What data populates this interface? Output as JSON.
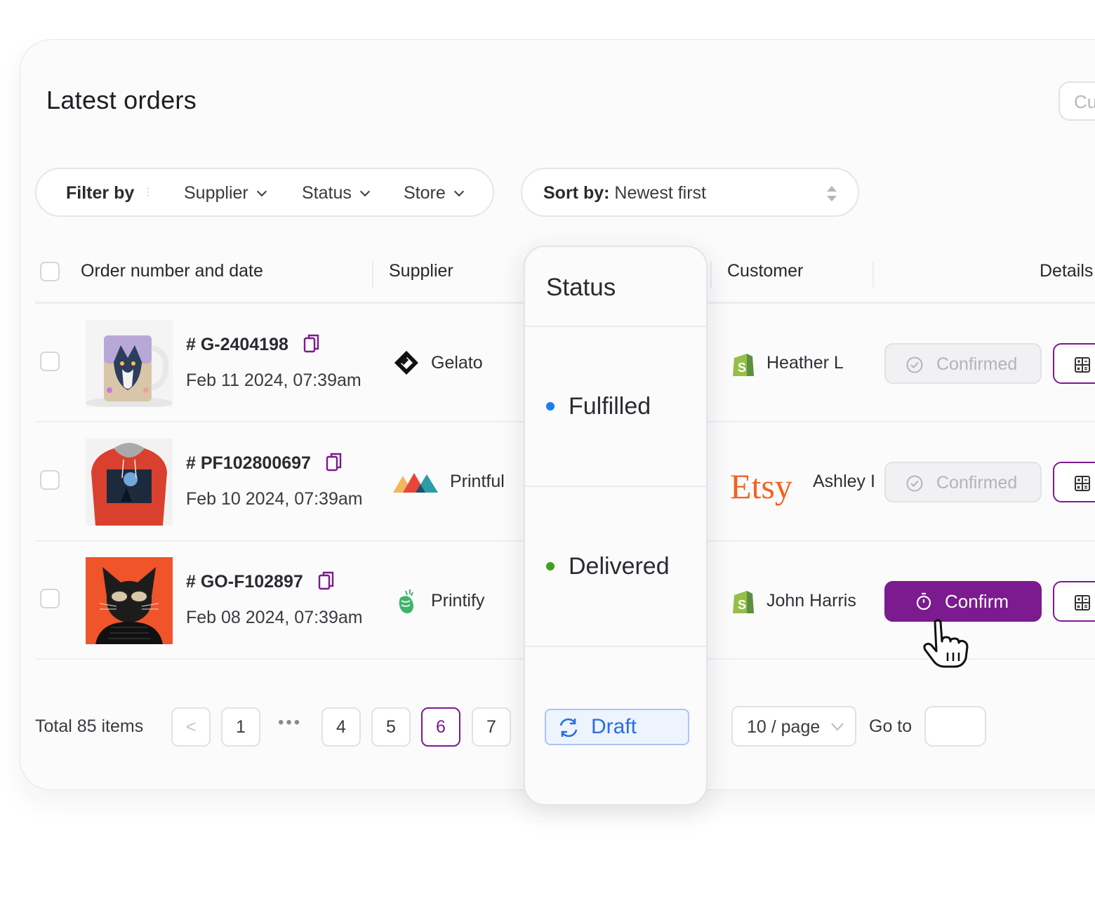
{
  "page": {
    "title": "Latest orders",
    "top_right_button": "Cu"
  },
  "filter": {
    "label": "Filter by",
    "items": [
      "Supplier",
      "Status",
      "Store"
    ]
  },
  "sort": {
    "label": "Sort by:",
    "value": "Newest first"
  },
  "table": {
    "headers": {
      "order": "Order number and date",
      "supplier": "Supplier",
      "customer": "Customer",
      "details": "Details"
    },
    "rows": [
      {
        "order_no": "# G-2404198",
        "date": "Feb 11 2024, 07:39am",
        "supplier": "Gelato",
        "supplier_icon": "gelato-logo",
        "store": "shopify",
        "customer": "Heather L",
        "action": "Confirmed",
        "action_state": "disabled"
      },
      {
        "order_no": "# PF102800697",
        "date": "Feb 10 2024, 07:39am",
        "supplier": "Printful",
        "supplier_icon": "printful-logo",
        "store": "etsy",
        "store_label": "Etsy",
        "customer": "Ashley I",
        "action": "Confirmed",
        "action_state": "disabled"
      },
      {
        "order_no": "# GO-F102897",
        "date": "Feb 08 2024, 07:39am",
        "supplier": "Printify",
        "supplier_icon": "printify-logo",
        "store": "shopify",
        "customer": "John Harris",
        "action": "Confirm",
        "action_state": "primary"
      }
    ]
  },
  "status_dropdown": {
    "title": "Status",
    "options": [
      {
        "label": "Fulfilled",
        "color": "#1e7cf2"
      },
      {
        "label": "Delivered",
        "color": "#3fa21e"
      }
    ],
    "draft_label": "Draft"
  },
  "pagination": {
    "total": "Total 85 items",
    "prev": "<",
    "pages": [
      "1",
      "4",
      "5",
      "6",
      "7"
    ],
    "current": "6",
    "ellipsis": "•••",
    "page_size": "10 / page",
    "goto": "Go to"
  },
  "colors": {
    "accent": "#7c1a8f",
    "draft_blue": "#2a6fe0",
    "etsy": "#f1641e",
    "shopify": "#95bf47"
  }
}
